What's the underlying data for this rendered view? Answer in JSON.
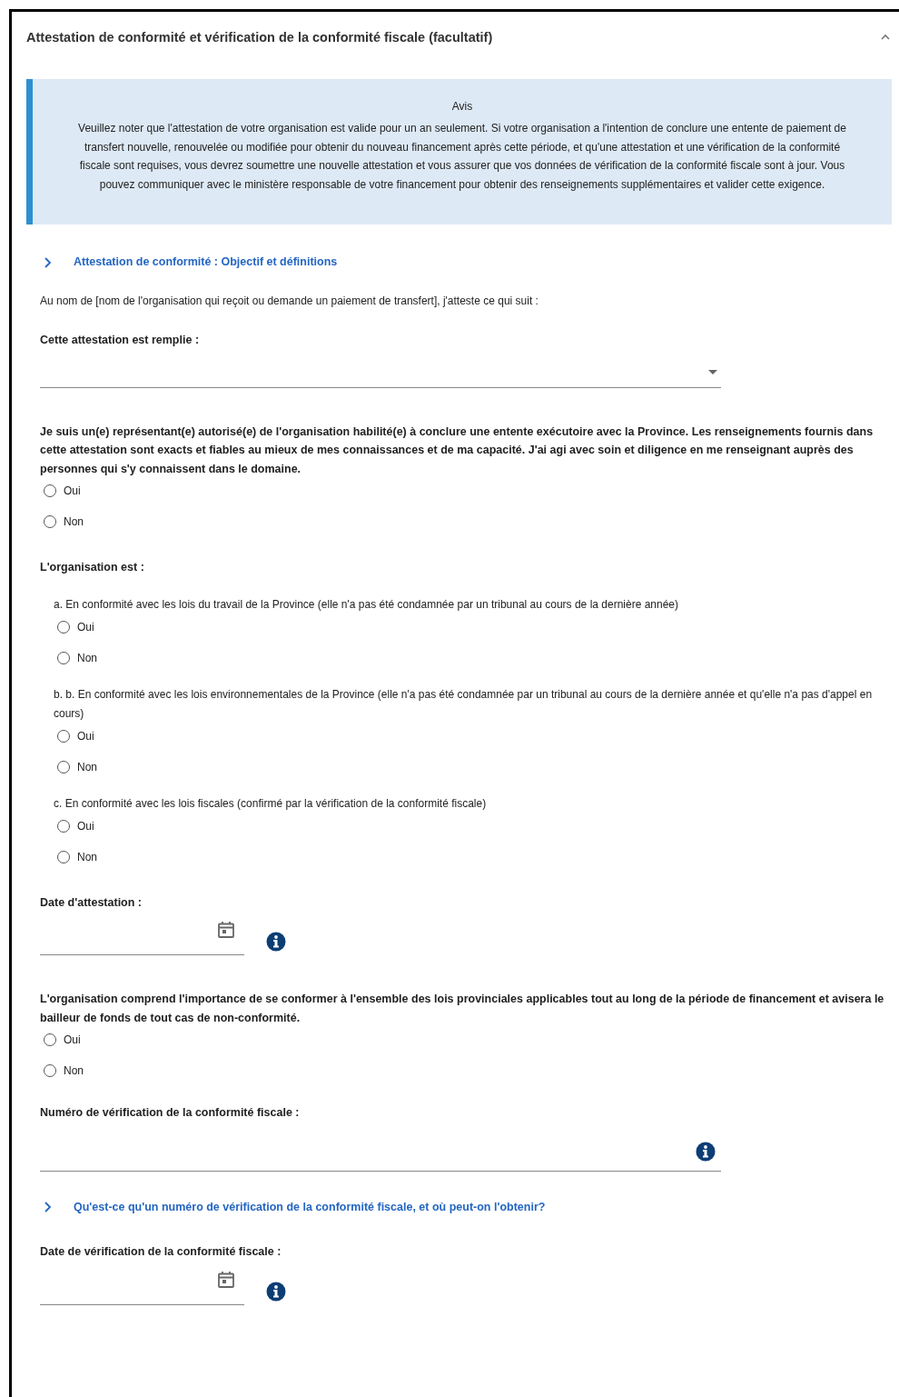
{
  "panel": {
    "title": "Attestation de conformité et vérification de la conformité fiscale (facultatif)",
    "expanded": true
  },
  "notice": {
    "title": "Avis",
    "text": "Veuillez noter que l'attestation de votre organisation est valide pour un an seulement. Si votre organisation a l'intention de conclure une entente de paiement de transfert nouvelle, renouvelée ou modifiée pour obtenir du nouveau financement après cette période, et qu'une attestation et une vérification de la conformité fiscale sont requises, vous devrez soumettre une nouvelle attestation et vous assurer que vos données de vérification de la conformité fiscale sont à jour. Vous pouvez communiquer avec le ministère responsable de votre financement pour obtenir des renseignements supplémentaires et valider cette exigence."
  },
  "items": [
    {
      "kind": "expander",
      "text": "Attestation de conformité : Objectif et définitions",
      "expanded": false
    },
    {
      "kind": "text",
      "text": "Au nom de [nom de l'organisation qui reçoit ou demande un paiement de transfert], j'atteste ce qui suit :"
    },
    {
      "kind": "select",
      "label": "Cette attestation est remplie :"
    },
    {
      "kind": "question",
      "label": "Je suis un(e) représentant(e) autorisé(e) de l'organisation habilité(e) à conclure une entente exécutoire avec la Province. Les renseignements fournis dans cette attestation sont exacts et fiables au mieux de mes connaissances et de ma capacité. J'ai agi avec soin et diligence en me renseignant auprès des personnes qui s'y connaissent dans le domaine.",
      "options": [
        {
          "label": "Oui",
          "selected": false
        },
        {
          "label": "Non",
          "selected": false
        }
      ]
    },
    {
      "kind": "heading",
      "text": "L'organisation est :"
    },
    {
      "kind": "subquestion",
      "label": "a. En conformité avec les lois du travail de la Province (elle n'a pas été condamnée par un tribunal au cours de la dernière année)",
      "options": [
        {
          "label": "Oui",
          "selected": false
        },
        {
          "label": "Non",
          "selected": false
        }
      ]
    },
    {
      "kind": "subquestion",
      "label": "b. b. En conformité avec les lois environnementales de la Province (elle n'a pas été condamnée par un tribunal au cours de la dernière année et qu'elle n'a pas d'appel en cours)",
      "options": [
        {
          "label": "Oui",
          "selected": false
        },
        {
          "label": "Non",
          "selected": false
        }
      ]
    },
    {
      "kind": "subquestion",
      "label": "c. En conformité avec les lois fiscales (confirmé par la vérification de la conformité fiscale)",
      "options": [
        {
          "label": "Oui",
          "selected": false
        },
        {
          "label": "Non",
          "selected": false
        }
      ]
    },
    {
      "kind": "date",
      "label": "Date d'attestation :"
    },
    {
      "kind": "question",
      "label": "L'organisation comprend l'importance de se conformer à l'ensemble des lois provinciales applicables tout au long de la période de financement et avisera le bailleur de fonds de tout cas de non-conformité.",
      "options": [
        {
          "label": "Oui",
          "selected": false
        },
        {
          "label": "Non",
          "selected": false
        }
      ]
    },
    {
      "kind": "textfield",
      "label": "Numéro de vérification de la conformité fiscale :"
    },
    {
      "kind": "expander",
      "text": "Qu'est-ce qu'un numéro de vérification de la conformité fiscale, et où peut-on l'obtenir?",
      "expanded": false
    },
    {
      "kind": "date",
      "label": "Date de vérification de la conformité fiscale :"
    }
  ]
}
